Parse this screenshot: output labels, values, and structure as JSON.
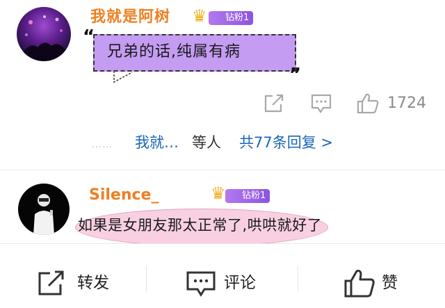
{
  "comments": [
    {
      "username": "我就是阿树",
      "badge": "钻粉1",
      "text": "兄弟的话,纯属有病",
      "quote_open": "“",
      "quote_close": "”",
      "likes": "1724",
      "reply_summary": {
        "dots": "……",
        "users": "我就…",
        "waiting": "等人",
        "count": "共77条回复 >"
      }
    },
    {
      "username": "Silence_",
      "badge": "钻粉1",
      "text": "如果是女朋友那太正常了,哄哄就好了"
    }
  ],
  "bottom_bar": {
    "repost_label": "转发",
    "comment_label": "评论",
    "like_label": "赞"
  },
  "icons": {
    "share": "share-icon",
    "comment": "comment-icon",
    "like": "thumbs-up-icon",
    "crown": "crown-icon"
  },
  "colors": {
    "username": "#ee7f22",
    "link": "#1a66b8",
    "badge": "#a46aea",
    "bubble1": "#c49cf2",
    "bubble2": "#f8d0e2",
    "icon_gray": "#a8a8a8"
  }
}
